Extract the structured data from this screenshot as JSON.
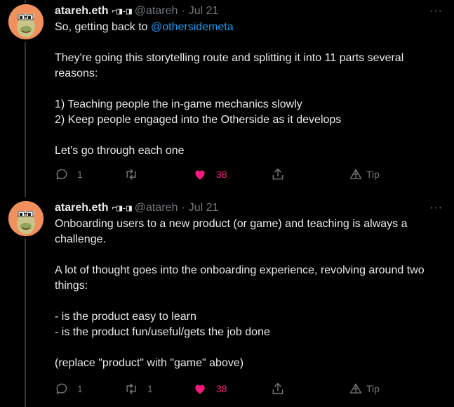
{
  "tweets": [
    {
      "author_name": "atareh.eth",
      "author_emoji": "⌐◨-◨",
      "handle": "@atareh",
      "separator": "·",
      "date": "Jul 21",
      "more_label": "···",
      "body_prefix": "So, getting back to ",
      "body_mention": "@othersidemeta",
      "body_paragraphs": [
        "",
        "They're going this storytelling route and splitting it into 11 parts several reasons:",
        "",
        "1) Teaching people the in-game mechanics slowly",
        "2) Keep people engaged into the Otherside as it develops",
        "",
        "Let's go through each one"
      ],
      "replies": "1",
      "retweets": "",
      "likes": "38",
      "liked": true,
      "tip_label": "Tip"
    },
    {
      "author_name": "atareh.eth",
      "author_emoji": "⌐◨-◨",
      "handle": "@atareh",
      "separator": "·",
      "date": "Jul 21",
      "more_label": "···",
      "body_paragraphs": [
        "Onboarding users to a new product (or game) and teaching is always a challenge.",
        "",
        "A lot of thought goes into the onboarding experience, revolving around two things:",
        "",
        "- is the product easy to learn",
        "- is the product fun/useful/gets the job done",
        "",
        "(replace \"product\" with \"game\" above)"
      ],
      "replies": "1",
      "retweets": "1",
      "likes": "38",
      "liked": true,
      "tip_label": "Tip"
    }
  ],
  "colors": {
    "background": "#000000",
    "text": "#e7e9ea",
    "muted": "#71767b",
    "link": "#1d9bf0",
    "like": "#f91880",
    "avatar_bg": "#f0905c",
    "thread_line": "#333639"
  },
  "icons": [
    "reply-icon",
    "retweet-icon",
    "heart-icon",
    "share-icon",
    "tip-icon",
    "more-icon"
  ]
}
